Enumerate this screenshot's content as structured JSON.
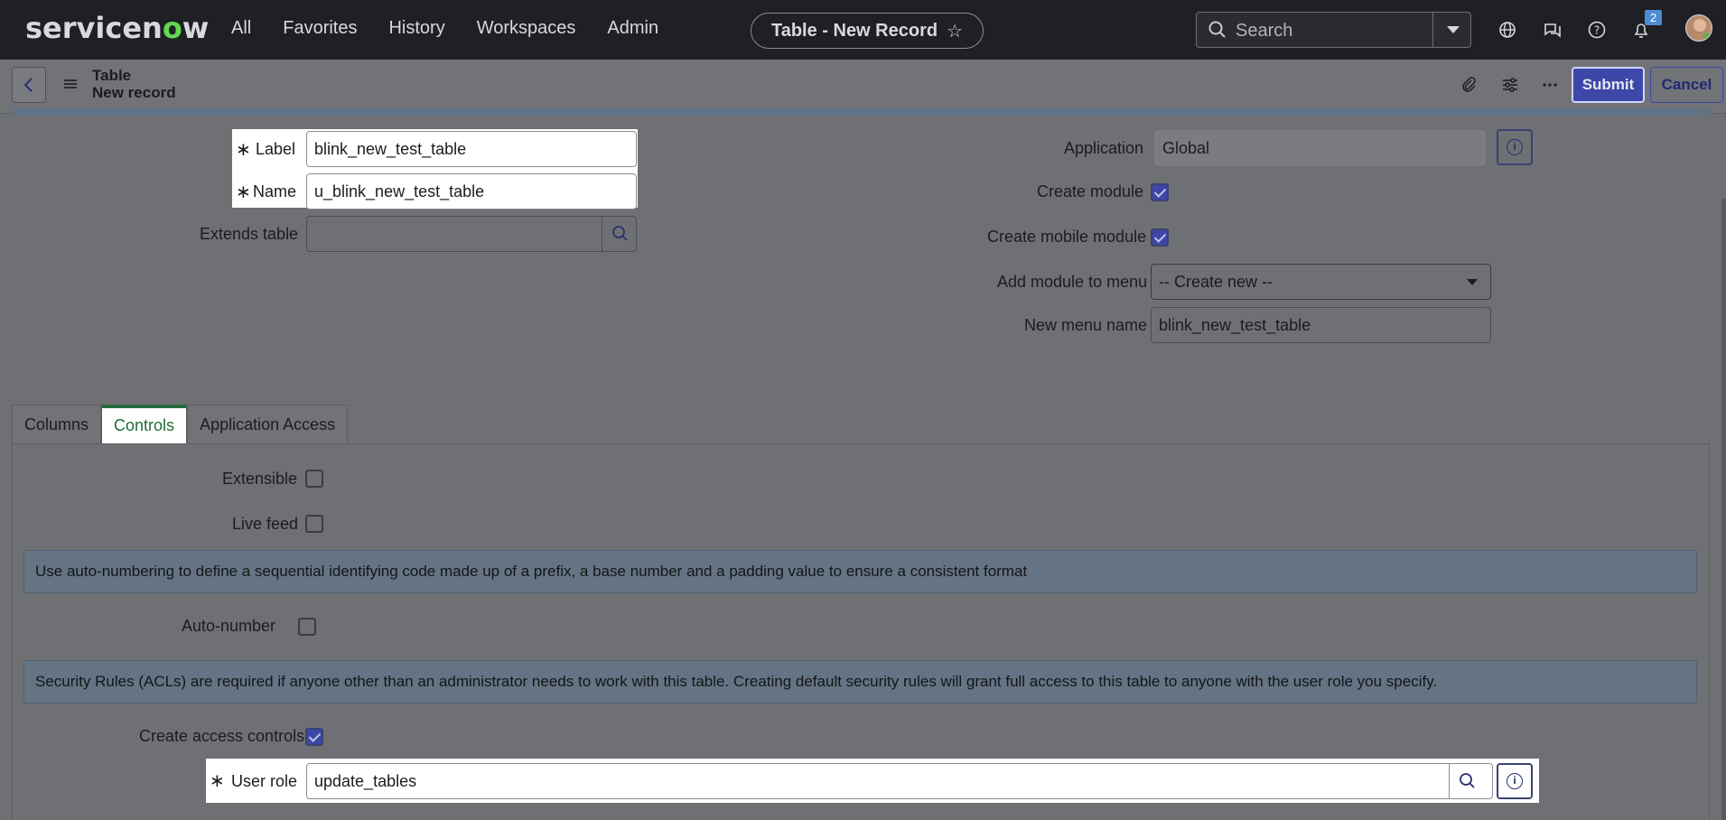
{
  "topnav": {
    "logo": "servicenow",
    "links": [
      "All",
      "Favorites",
      "History",
      "Workspaces",
      "Admin"
    ],
    "context_title": "Table - New Record",
    "search_placeholder": "Search",
    "notification_count": "2",
    "icons": [
      "globe-icon",
      "chat-icon",
      "help-icon",
      "bell-icon"
    ]
  },
  "header": {
    "record_type": "Table",
    "record_subtitle": "New record",
    "submit_label": "Submit",
    "cancel_label": "Cancel"
  },
  "form": {
    "label_label": "Label",
    "label_value": "blink_new_test_table",
    "name_label": "Name",
    "name_value": "u_blink_new_test_table",
    "extends_label": "Extends table",
    "extends_value": "",
    "application_label": "Application",
    "application_value": "Global",
    "create_module_label": "Create module",
    "create_module_checked": true,
    "create_mobile_module_label": "Create mobile module",
    "create_mobile_module_checked": true,
    "add_module_label": "Add module to menu",
    "add_module_value": "-- Create new --",
    "new_menu_name_label": "New menu name",
    "new_menu_name_value": "blink_new_test_table"
  },
  "tabs": [
    {
      "label": "Columns",
      "active": false
    },
    {
      "label": "Controls",
      "active": true
    },
    {
      "label": "Application Access",
      "active": false
    }
  ],
  "controls": {
    "extensible_label": "Extensible",
    "extensible_checked": false,
    "live_feed_label": "Live feed",
    "live_feed_checked": false,
    "auto_number_info": "Use auto-numbering to define a sequential identifying code made up of a prefix, a base number and a padding value to ensure a consistent format",
    "auto_number_label": "Auto-number",
    "auto_number_checked": false,
    "security_info": "Security Rules (ACLs) are required if anyone other than an administrator needs to work with this table. Creating default security rules will grant full access to this table to anyone with the user role you specify.",
    "create_access_label": "Create access controls",
    "create_access_checked": true,
    "user_role_label": "User role",
    "user_role_value": "update_tables"
  },
  "colors": {
    "nav_bg": "#1e2025",
    "accent": "#3d47a8",
    "active_tab": "#27693e",
    "overlay_bg": "#6f7073"
  }
}
